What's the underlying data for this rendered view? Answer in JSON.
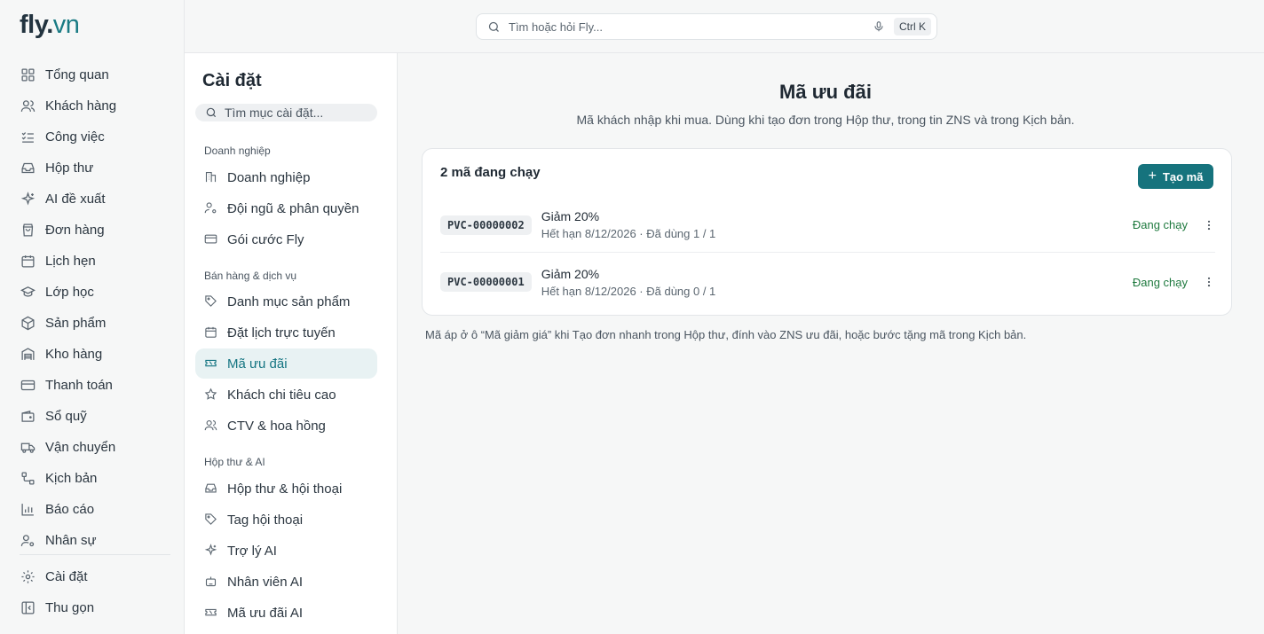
{
  "brand": {
    "name": "fly",
    "dot": ".",
    "tld": "vn"
  },
  "nav": {
    "items": [
      {
        "label": "Tổng quan",
        "icon": "grid-icon"
      },
      {
        "label": "Khách hàng",
        "icon": "users-icon"
      },
      {
        "label": "Công việc",
        "icon": "checklist-icon"
      },
      {
        "label": "Hộp thư",
        "icon": "inbox-icon"
      },
      {
        "label": "AI đề xuất",
        "icon": "sparkles-icon"
      },
      {
        "label": "Đơn hàng",
        "icon": "shopping-bag-icon"
      },
      {
        "label": "Lịch hẹn",
        "icon": "calendar-icon"
      },
      {
        "label": "Lớp học",
        "icon": "graduation-cap-icon"
      },
      {
        "label": "Sản phẩm",
        "icon": "box-icon"
      },
      {
        "label": "Kho hàng",
        "icon": "warehouse-icon"
      },
      {
        "label": "Thanh toán",
        "icon": "credit-card-icon"
      },
      {
        "label": "Sổ quỹ",
        "icon": "wallet-icon"
      },
      {
        "label": "Vận chuyển",
        "icon": "truck-icon"
      },
      {
        "label": "Kịch bản",
        "icon": "workflow-icon"
      },
      {
        "label": "Báo cáo",
        "icon": "bar-chart-icon"
      },
      {
        "label": "Nhân sự",
        "icon": "user-settings-icon"
      }
    ],
    "bottom": [
      {
        "label": "Cài đặt",
        "icon": "gear-icon"
      },
      {
        "label": "Thu gọn",
        "icon": "collapse-icon"
      }
    ]
  },
  "search": {
    "placeholder": "Tìm hoặc hỏi Fly...",
    "shortcut": "Ctrl K"
  },
  "settings": {
    "title": "Cài đặt",
    "search_placeholder": "Tìm mục cài đặt...",
    "groups": [
      {
        "label": "Doanh nghiệp"
      },
      {
        "label": "Bán hàng & dịch vụ"
      },
      {
        "label": "Hộp thư & AI"
      }
    ],
    "items": [
      {
        "label": "Doanh nghiệp"
      },
      {
        "label": "Đội ngũ & phân quyền"
      },
      {
        "label": "Gói cước Fly"
      },
      {
        "label": "Danh mục sản phẩm"
      },
      {
        "label": "Đặt lịch trực tuyến"
      },
      {
        "label": "Mã ưu đãi"
      },
      {
        "label": "Khách chi tiêu cao"
      },
      {
        "label": "CTV & hoa hồng"
      },
      {
        "label": "Hộp thư & hội thoại"
      },
      {
        "label": "Tag hội thoại"
      },
      {
        "label": "Trợ lý AI"
      },
      {
        "label": "Nhân viên AI"
      },
      {
        "label": "Mã ưu đãi AI"
      }
    ]
  },
  "main": {
    "title": "Mã ưu đãi",
    "subtitle": "Mã khách nhập khi mua. Dùng khi tạo đơn trong Hộp thư, trong tin ZNS và trong Kịch bản.",
    "card_title": "2 mã đang chạy",
    "create_label": "Tạo mã",
    "codes": [
      {
        "code": "PVC-00000002",
        "title": "Giảm 20%",
        "meta": "Hết hạn 8/12/2026 · Đã dùng 1 / 1",
        "status": "Đang chạy"
      },
      {
        "code": "PVC-00000001",
        "title": "Giảm 20%",
        "meta": "Hết hạn 8/12/2026 · Đã dùng 0 / 1",
        "status": "Đang chạy"
      }
    ],
    "footnote": "Mã áp ở ô “Mã giảm giá” khi Tạo đơn nhanh trong Hộp thư, đính vào ZNS ưu đãi, hoặc bước tặng mã trong Kịch bản."
  },
  "colors": {
    "accent": "#16737d",
    "active_bg": "#e8f2f3",
    "status_green": "#1f7a3f",
    "brand_tld": "#1a7b84"
  }
}
